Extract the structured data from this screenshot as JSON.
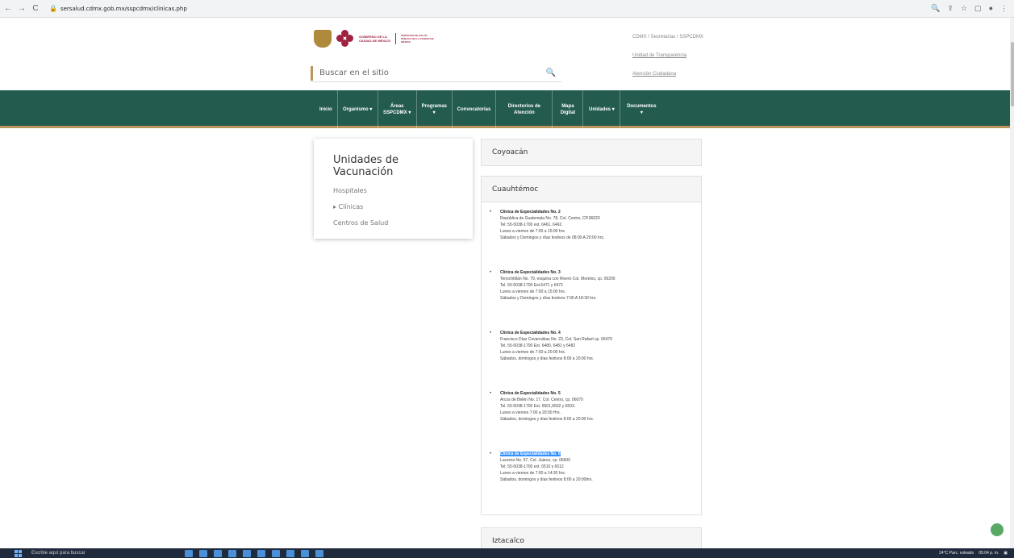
{
  "browser": {
    "url": "sersalud.cdmx.gob.mx/sspcdmx/clinicas.php"
  },
  "header": {
    "logo_text_1": "GOBIERNO DE LA",
    "logo_text_2": "CIUDAD DE MÉXICO",
    "logo_text_3": "SERVICIOS DE SALUD PÚBLICA DE LA CIUDAD DE MÉXICO",
    "search_placeholder": "Buscar en el sitio",
    "breadcrumb": "CDMX / Secretarías / SSPCDMX",
    "link_transparencia": "Unidad de Transparencia",
    "link_atencion": "Atención Ciudadana"
  },
  "nav": [
    {
      "label": "Inicio"
    },
    {
      "label": "Organismo ▾"
    },
    {
      "label": "Áreas SSPCDMX ▾"
    },
    {
      "label": "Programas ▾"
    },
    {
      "label": "Convocatorias"
    },
    {
      "label": "Directorios de Atención"
    },
    {
      "label": "Mapa Digital"
    },
    {
      "label": "Unidades ▾"
    },
    {
      "label": "Documentos ▾"
    }
  ],
  "sidebar": {
    "title": "Unidades de Vacunación",
    "items": [
      {
        "label": "Hospitales"
      },
      {
        "label": "▸ Clínicas"
      },
      {
        "label": "Centros de Salud"
      }
    ]
  },
  "panels": {
    "coyoacan": "Coyoacán",
    "cuauhtemoc": "Cuauhtémoc",
    "iztacalco": "Iztacalco"
  },
  "clinics": [
    {
      "name": "Clínica de Especialidades No. 2",
      "address": "República de Guatemala No. 78, Col. Centro, CP.06020",
      "tel": "Tel: 55-5038-1700 ext. 6461, 6462.",
      "hours": "Lunes a viernes de 7:00 a 15:00 hrs.",
      "weekend": "Sábados y Domingos y días festivos de 08:00 A 20:00 hrs."
    },
    {
      "name": "Clínica de Especialidades No. 3",
      "address": "Tenochtitlán No. 79, esquina con Rivero Col. Morelos, cp. 06200",
      "tel": "Tel. 55-5038-1700 Ext.6471 y 6472",
      "hours": "Lunes a viernes de 7:00 a 15:00 hrs.",
      "weekend": "Sábados y Domingos y días festivos 7:00 A 18:30 hrs."
    },
    {
      "name": "Clínica de Especialidades No. 4",
      "address": "Francisco Díaz Covarrubias No. 23, Col. San Rafael cp. 06470",
      "tel": "Tel. 55-5038-1700 Ext. 6480, 6481 y 6482",
      "hours": "Lunes a viernes de 7:00 a 20:00 hrs.",
      "weekend": "Sábados, domingos y días festivos 8:00 a 20:00 hrs."
    },
    {
      "name": "Clínica de Especialidades No. 5",
      "address": "Arcos de Belén No. 17, Col. Centro, cp. 06070",
      "tel": "Tel. 55-5038-1700 Ext. 6501,6502 y 6503.",
      "hours": "Lunes a viernes 7:00 a 20:00 Hrs.",
      "weekend": "Sábados, domingos y días festivos 8:00 a 20:00 hrs."
    },
    {
      "name": "Clínica de Especialidades No. 6",
      "address": "Lucerna No. 67, Col. Juárez, cp. 06600",
      "tel": "Tel: 55-5038-1700 ext. 6510 y 6512",
      "hours": "Lunes a viernes de 7:00 a 14:30 hrs.",
      "weekend": "Sábados, domingos y días festivos 8:00 a 20:00hrs."
    }
  ],
  "taskbar": {
    "search": "Escribe aquí para buscar",
    "weather": "24°C  Parc. soleado",
    "time": "05:04 p. m."
  }
}
